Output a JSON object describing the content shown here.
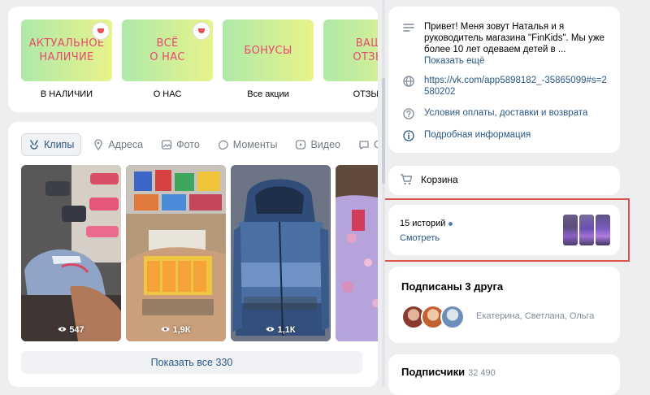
{
  "menu": {
    "tiles": [
      {
        "image_text": "АКТУАЛЬНОЕ\nНАЛИЧИЕ",
        "label": "В НАЛИЧИИ"
      },
      {
        "image_text": "ВСЁ\nО НАС",
        "label": "О НАС"
      },
      {
        "image_text": "БОНУСЫ",
        "label": "Все акции"
      },
      {
        "image_text": "ВАШ\nОТЗЫ",
        "label": "ОТЗЫВ"
      }
    ]
  },
  "clips_section": {
    "tabs": [
      {
        "label": "Клипы",
        "icon": "clips-icon",
        "active": true
      },
      {
        "label": "Адреса",
        "icon": "location-pin-icon"
      },
      {
        "label": "Фото",
        "icon": "photo-icon"
      },
      {
        "label": "Моменты",
        "icon": "moments-icon"
      },
      {
        "label": "Видео",
        "icon": "video-icon"
      },
      {
        "label": "Об",
        "icon": "chat-icon"
      }
    ],
    "clips": [
      {
        "views": "547"
      },
      {
        "views": "1,9К"
      },
      {
        "views": "1,1К"
      },
      {
        "views": ""
      }
    ],
    "show_all_label": "Показать все 330"
  },
  "info": {
    "description": "Привет! Меня зовут Наталья и я руководитель магазина \"FinKids\". Мы уже более 10 лет одеваем детей в ...",
    "show_more": "Показать ещё",
    "link": "https://vk.com/app5898182_-35865099#s=2580202",
    "terms_link": "Условия оплаты, доставки и возврата",
    "details_link": "Подробная информация"
  },
  "cart": {
    "label": "Корзина"
  },
  "stories": {
    "count_label": "15 историй",
    "watch_label": "Смотреть"
  },
  "friends": {
    "title": "Подписаны 3 друга",
    "names": "Екатерина, Светлана, Ольга"
  },
  "followers": {
    "title": "Подписчики",
    "count": "32 490"
  },
  "colors": {
    "accent": "#2a5885",
    "tile_text": "#e64a6f",
    "highlight": "#d9534f",
    "page_bg": "#edeef0"
  }
}
